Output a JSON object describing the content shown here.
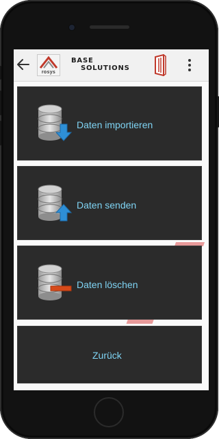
{
  "toolbar": {
    "logo_small_text": "rosys",
    "brand_line1": "BASE",
    "brand_line2": "SOLUTIONS"
  },
  "menu": {
    "import_label": "Daten importieren",
    "send_label": "Daten senden",
    "delete_label": "Daten löschen",
    "back_label": "Zurück"
  },
  "colors": {
    "tile_background": "#2b2b2b",
    "tile_text": "#7fd4f4",
    "import_arrow": "#2e8fd6",
    "send_arrow": "#2e8fd6",
    "delete_bar": "#d64a1a"
  }
}
